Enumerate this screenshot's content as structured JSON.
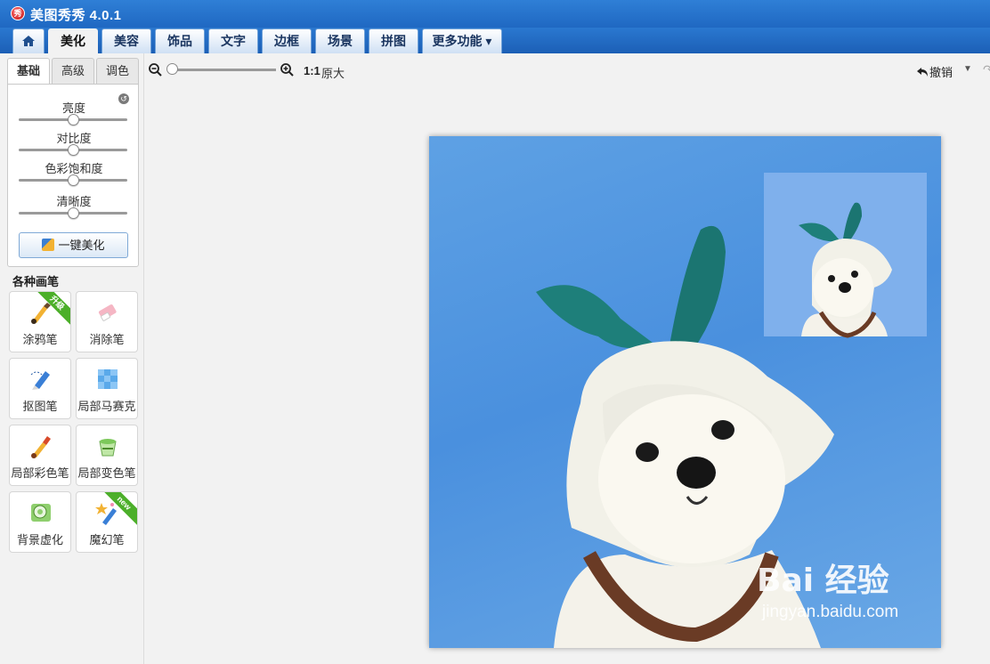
{
  "app": {
    "title": "美图秀秀 4.0.1",
    "logo_text": "秀"
  },
  "tabs": [
    {
      "label": "美化",
      "active": true
    },
    {
      "label": "美容"
    },
    {
      "label": "饰品"
    },
    {
      "label": "文字"
    },
    {
      "label": "边框"
    },
    {
      "label": "场景"
    },
    {
      "label": "拼图"
    },
    {
      "label": "更多功能 ▾"
    }
  ],
  "subtabs": [
    "基础",
    "高级",
    "调色"
  ],
  "sliders": [
    {
      "label": "亮度",
      "value": 50
    },
    {
      "label": "对比度",
      "value": 50
    },
    {
      "label": "色彩饱和度",
      "value": 50
    },
    {
      "label": "清晰度",
      "value": 50
    }
  ],
  "one_click_label": "一键美化",
  "brushes_title": "各种画笔",
  "brushes": [
    {
      "label": "涂鸦笔",
      "badge": "升级"
    },
    {
      "label": "消除笔"
    },
    {
      "label": "抠图笔"
    },
    {
      "label": "局部马赛克"
    },
    {
      "label": "局部彩色笔"
    },
    {
      "label": "局部变色笔"
    },
    {
      "label": "背景虚化"
    },
    {
      "label": "魔幻笔",
      "badge": "new"
    }
  ],
  "toolbar": {
    "ratio": "1:1",
    "original_size": "原大",
    "undo": "撤销"
  },
  "watermark": {
    "main": "Bai 经验",
    "sub": "jingyan.baidu.com"
  },
  "colors": {
    "titlebar": "#2f7fd6",
    "sky": "#4a90de",
    "ribbon": "#4caf2a"
  }
}
